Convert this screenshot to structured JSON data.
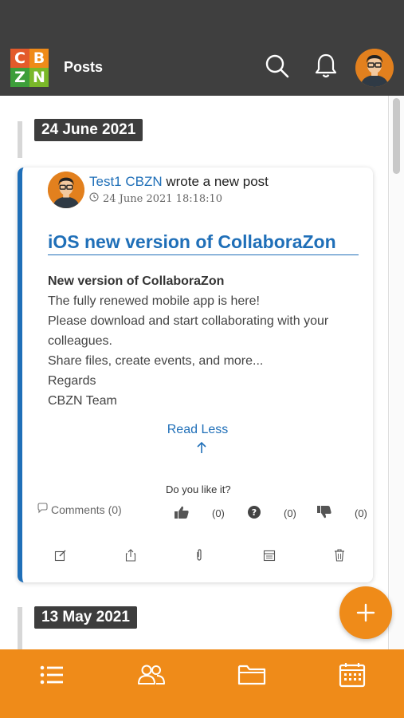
{
  "app": {
    "logo": {
      "letters": [
        "C",
        "B",
        "Z",
        "N"
      ],
      "colors": [
        "#e35a2b",
        "#ef8b19",
        "#3d9e3a",
        "#7ab829"
      ]
    },
    "title": "Posts"
  },
  "header": {
    "icons": [
      "search-icon",
      "bell-icon",
      "avatar"
    ]
  },
  "feed": {
    "groups": [
      {
        "date": "24 June 2021",
        "post": {
          "author": "Test1 CBZN",
          "action": " wrote a new post",
          "timestamp": "24 June 2021 18:18:10",
          "title": "iOS new version of CollaboraZon",
          "body_heading": "New version of CollaboraZon",
          "body_lines": [
            "The fully renewed mobile app is here!",
            "Please download and start collaborating with your colleagues.",
            "Share files, create events, and more...",
            "Regards",
            "CBZN Team"
          ],
          "read_less": "Read Less",
          "like_prompt": "Do you like it?",
          "comments": "Comments (0)",
          "reactions": {
            "like": "(0)",
            "question": "(0)",
            "dislike": "(0)"
          },
          "actions": [
            "edit-icon",
            "share-icon",
            "attachment-icon",
            "calendar-icon",
            "delete-icon"
          ]
        }
      },
      {
        "date": "13 May 2021"
      }
    ]
  },
  "bottom_nav": {
    "items": [
      "list-icon",
      "users-icon",
      "folder-icon",
      "calendar-icon"
    ]
  },
  "fab": {
    "label": "+"
  },
  "colors": {
    "header": "#3f3f3f",
    "accent": "#ef8b19",
    "link": "#1f6fb8"
  }
}
